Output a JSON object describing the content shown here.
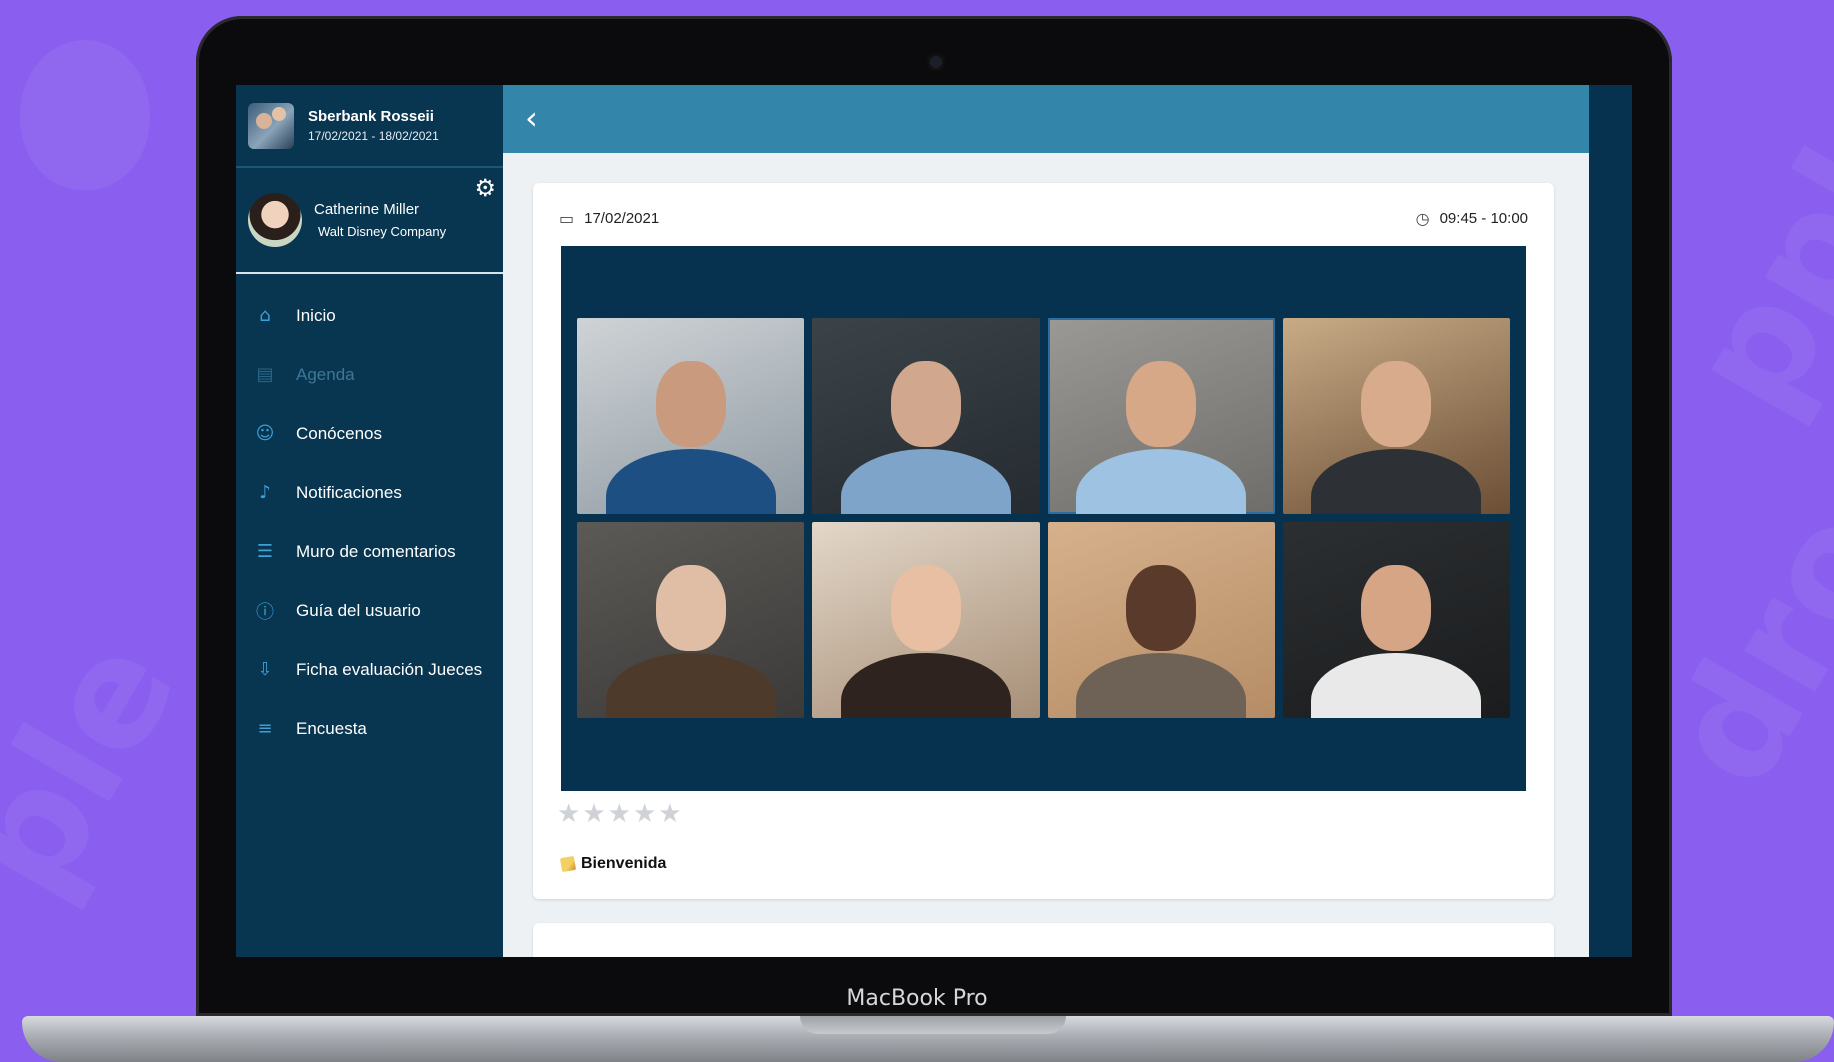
{
  "event": {
    "title": "Sberbank Rosseii",
    "dates": "17/02/2021 - 18/02/2021"
  },
  "user": {
    "name": "Catherine Miller",
    "company": "Walt Disney Company"
  },
  "menu": [
    {
      "label": "Inicio",
      "icon": "home-icon",
      "glyph": "⌂",
      "active": true
    },
    {
      "label": "Agenda",
      "icon": "agenda-icon",
      "glyph": "▤",
      "active": false
    },
    {
      "label": "Conócenos",
      "icon": "about-icon",
      "glyph": "☺",
      "active": true
    },
    {
      "label": "Notificaciones",
      "icon": "bell-icon",
      "glyph": "♪",
      "active": true
    },
    {
      "label": "Muro de comentarios",
      "icon": "comments-icon",
      "glyph": "☰",
      "active": true
    },
    {
      "label": "Guía del usuario",
      "icon": "info-icon",
      "glyph": "ⓘ",
      "active": true
    },
    {
      "label": "Ficha evaluación Jueces",
      "icon": "download-icon",
      "glyph": "⇩",
      "active": true
    },
    {
      "label": "Encuesta",
      "icon": "list-icon",
      "glyph": "≡",
      "active": true
    }
  ],
  "session": {
    "date": "17/02/2021",
    "time": "09:45 - 10:00",
    "title": "Bienvenida",
    "rating_stars": 5,
    "rating_value": 0
  },
  "device": {
    "label": "MacBook Pro"
  },
  "colors": {
    "background": "#8a5ff0",
    "sidebar": "#08354f",
    "topbar": "#3385aa",
    "accent": "#3ba1d7"
  }
}
